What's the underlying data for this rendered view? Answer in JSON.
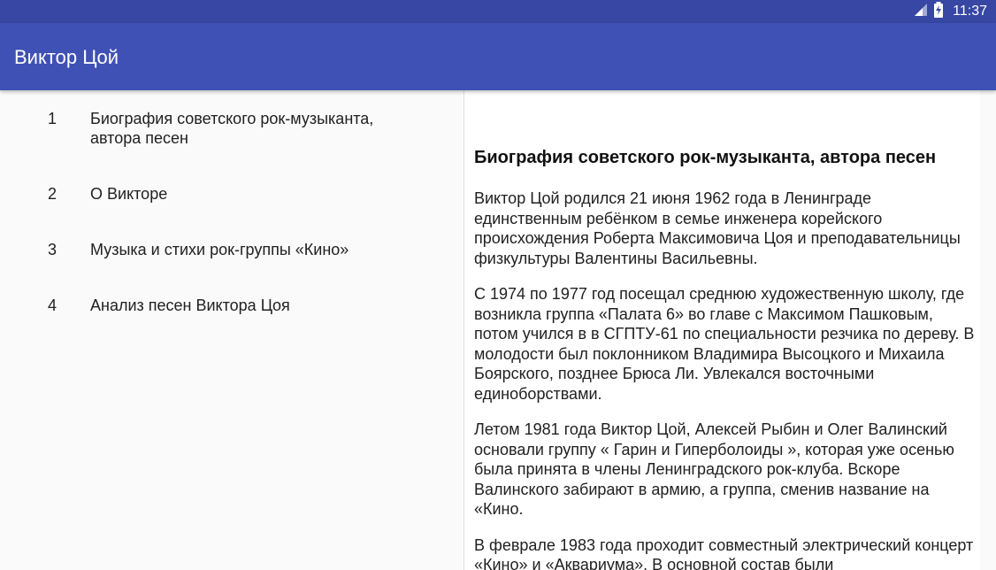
{
  "status_bar": {
    "time": "11:37",
    "icons": [
      "signal-icon",
      "battery-charging-icon"
    ]
  },
  "app_bar": {
    "title": "Виктор Цой"
  },
  "list": {
    "items": [
      {
        "number": "1",
        "title": "Биография советского рок-музыканта, автора песен"
      },
      {
        "number": "2",
        "title": "О Викторе"
      },
      {
        "number": "3",
        "title": "Музыка и стихи рок-группы «Кино»"
      },
      {
        "number": "4",
        "title": "Анализ песен Виктора Цоя"
      }
    ]
  },
  "detail": {
    "heading": "Биография советского рок-музыканта, автора песен",
    "paragraphs": [
      "Виктор Цой родился 21 июня 1962 года в Ленинграде единственным ребёнком в семье инженера корейского происхождения Роберта Максимовича Цоя и преподавательницы физкультуры Валентины Васильевны.",
      "С 1974 по 1977 год посещал среднюю художественную школу, где возникла группа «Палата 6» во главе с Максимом Пашковым, потом учился в в СГПТУ-61 по специальности резчика по дереву. В молодости был поклонником Владимира Высоцкого и Михаила Боярского, позднее Брюса Ли. Увлекался восточными единоборствами.",
      "Летом 1981 года Виктор Цой, Алексей Рыбин и Олег Валинский основали группу « Гарин и Гиперболоиды », которая уже осенью была принята в члены Ленинградского рок-клуба. Вскоре Валинского забирают в армию, а группа, сменив название на «Кино.",
      "В феврале 1983 года проходит совместный электрический концерт «Кино» и «Аквариума». В основной состав были"
    ]
  },
  "colors": {
    "status_bar": "#3747a3",
    "app_bar": "#3f51b5",
    "text_primary": "#212121"
  }
}
